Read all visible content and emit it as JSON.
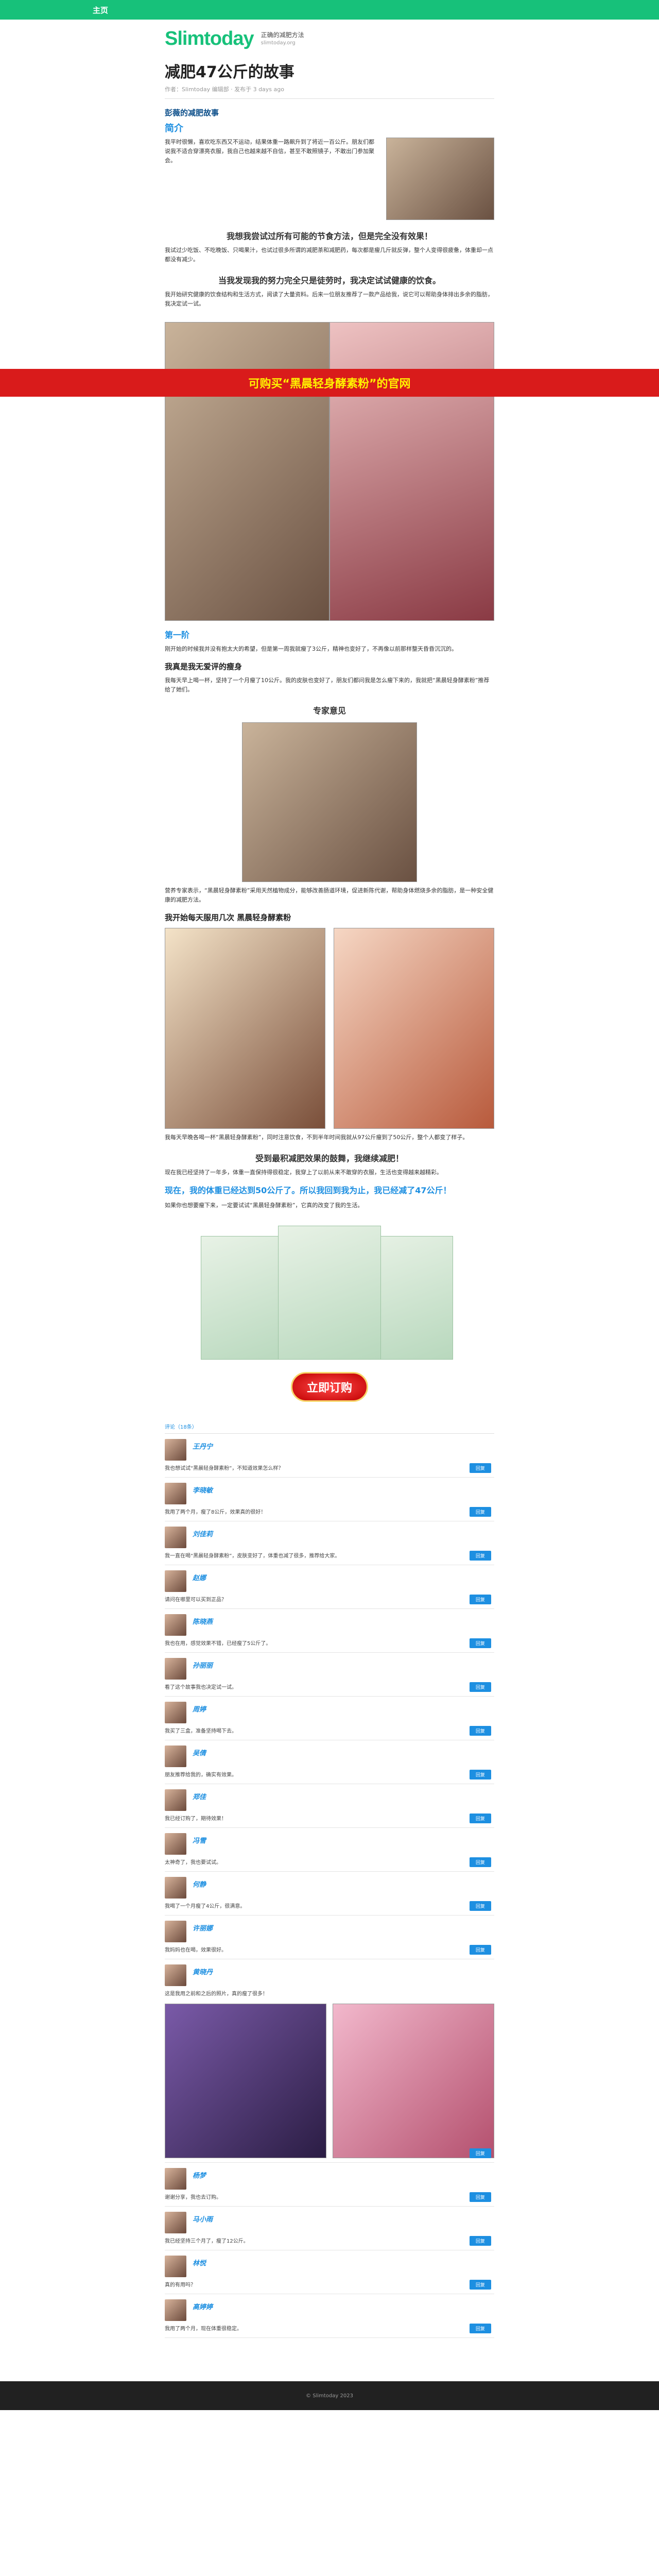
{
  "topbar": {
    "home_label": "主页"
  },
  "brand": {
    "logo": "Slimtoday",
    "tagline": "正确的减肥方法",
    "tagline_sub": "slimtoday.org"
  },
  "article": {
    "title": "减肥47公斤的故事",
    "byline": "作者：Slimtoday 编辑部 · 发布于 3 days ago",
    "section_label": "彭薇的减肥故事",
    "intro_name": "简介",
    "intro_text": "我平时很懒，喜欢吃东西又不运动，结果体重一路飙升到了将近一百公斤。朋友们都说我不适合穿漂亮衣服，我自己也越来越不自信，甚至不敢照镜子，不敢出门参加聚会。",
    "question": "我想我尝试过所有可能的节食方法，但是完全没有效果！",
    "paragraph1": "我试过少吃饭、不吃晚饭、只喝果汁，也试过很多所谓的减肥茶和减肥药，每次都是瘦几斤就反弹，整个人变得很疲惫，体重却一点都没有减少。",
    "commitment": "当我发现我的努力完全只是徒劳时，我决定试试健康的饮食。",
    "paragraph2": "我开始研究健康的饮食结构和生活方式，阅读了大量资料。后来一位朋友推荐了一款产品给我，说它可以帮助身体排出多余的脂肪，我决定试一试。",
    "banner": "可购买“黑晨轻身酵素粉”的官网",
    "caption": "第一阶",
    "paragraph3": "刚开始的时候我并没有抱太大的希望，但是第一周我就瘦了3公斤，精神也变好了，不再像以前那样整天昏昏沉沉的。",
    "heading_love": "我真是我无爱评的瘦身",
    "paragraph4": "我每天早上喝一杯，坚持了一个月瘦了10公斤。我的皮肤也变好了，朋友们都问我是怎么瘦下来的，我就把“黑晨轻身酵素粉”推荐给了她们。",
    "expert_label": "专家意见",
    "paragraph5": "营养专家表示，“黑晨轻身酵素粉”采用天然植物成分，能够改善肠道环境，促进新陈代谢，帮助身体燃烧多余的脂肪，是一种安全健康的减肥方法。",
    "heading_product": "我开始每天服用几次 黑晨轻身酵素粉",
    "paragraph6": "我每天早晚各喝一杯“黑晨轻身酵素粉”，同时注意饮食，不到半年时间我就从97公斤瘦到了50公斤，整个人都变了样子。",
    "heading_question": "受到最积减肥效果的鼓舞，我继续减肥！",
    "paragraph7": "现在我已经坚持了一年多，体重一直保持得很稳定，我穿上了以前从来不敢穿的衣服，生活也变得越来越精彩。",
    "quote": "现在，我的体重已经达到50公斤了。所以我回到我为止，我已经减了47公斤！",
    "paragraph8": "如果你也想要瘦下来，一定要试试“黑晨轻身酵素粉”，它真的改变了我的生活。",
    "order_button": "立即订购",
    "comments_label": "评论（18条）"
  },
  "comments": [
    {
      "name": "王丹宁",
      "text": "我也想试试“黑晨轻身酵素粉”，不知道效果怎么样？",
      "like": "回复"
    },
    {
      "name": "李晓敏",
      "text": "我用了两个月，瘦了8公斤，效果真的很好！",
      "like": "回复"
    },
    {
      "name": "刘佳莉",
      "text": "我一直在喝“黑晨轻身酵素粉”，皮肤变好了，体重也减了很多，推荐给大家。",
      "like": "回复"
    },
    {
      "name": "赵娜",
      "text": "请问在哪里可以买到正品？",
      "like": "回复"
    },
    {
      "name": "陈晓燕",
      "text": "我也在用，感觉效果不错，已经瘦了5公斤了。",
      "like": "回复"
    },
    {
      "name": "孙丽丽",
      "text": "看了这个故事我也决定试一试。",
      "like": "回复"
    },
    {
      "name": "周婷",
      "text": "我买了三盒，准备坚持喝下去。",
      "like": "回复"
    },
    {
      "name": "吴倩",
      "text": "朋友推荐给我的，确实有效果。",
      "like": "回复"
    },
    {
      "name": "郑佳",
      "text": "我已经订购了，期待效果！",
      "like": "回复"
    },
    {
      "name": "冯雪",
      "text": "太神奇了，我也要试试。",
      "like": "回复"
    },
    {
      "name": "何静",
      "text": "我喝了一个月瘦了4公斤，很满意。",
      "like": "回复"
    },
    {
      "name": "许丽娜",
      "text": "我妈妈也在喝，效果很好。",
      "like": "回复"
    },
    {
      "name": "黄晓丹",
      "text": "这是我用之前和之后的照片，真的瘦了很多！",
      "like": "回复"
    },
    {
      "name": "杨梦",
      "text": "谢谢分享，我也去订购。",
      "like": "回复"
    },
    {
      "name": "马小雨",
      "text": "我已经坚持三个月了，瘦了12公斤。",
      "like": "回复"
    },
    {
      "name": "林悦",
      "text": "真的有用吗？",
      "like": "回复"
    },
    {
      "name": "高婷婷",
      "text": "我用了两个月，现在体重很稳定。",
      "like": "回复"
    }
  ],
  "footer": {
    "text": "© Slimtoday 2023"
  }
}
